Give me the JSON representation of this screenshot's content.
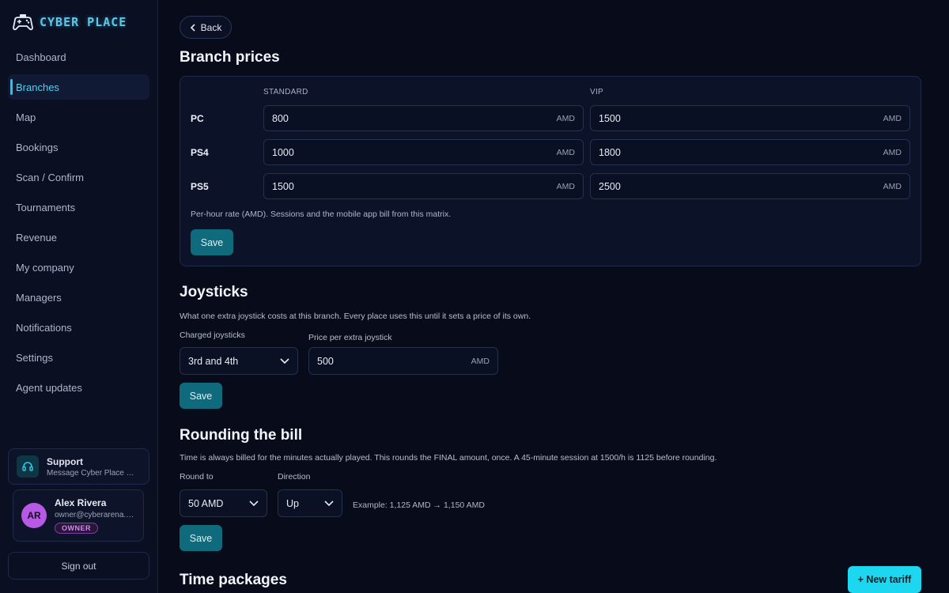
{
  "brand": {
    "name": "CYBER PLACE",
    "icon": "gamepad-icon"
  },
  "sidebar": {
    "items": [
      {
        "label": "Dashboard",
        "active": false
      },
      {
        "label": "Branches",
        "active": true
      },
      {
        "label": "Map",
        "active": false
      },
      {
        "label": "Bookings",
        "active": false
      },
      {
        "label": "Scan / Confirm",
        "active": false
      },
      {
        "label": "Tournaments",
        "active": false
      },
      {
        "label": "Revenue",
        "active": false
      },
      {
        "label": "My company",
        "active": false
      },
      {
        "label": "Managers",
        "active": false
      },
      {
        "label": "Notifications",
        "active": false
      },
      {
        "label": "Settings",
        "active": false
      },
      {
        "label": "Agent updates",
        "active": false
      }
    ],
    "support": {
      "title": "Support",
      "subtitle": "Message Cyber Place su...",
      "icon": "headset-icon"
    },
    "user": {
      "initials": "AR",
      "name": "Alex Rivera",
      "email": "owner@cyberarena.d...",
      "role": "OWNER"
    },
    "sign_out": "Sign out"
  },
  "main": {
    "back_label": "Back",
    "branch_prices": {
      "title": "Branch prices",
      "col_standard": "STANDARD",
      "col_vip": "VIP",
      "unit": "AMD",
      "rows": [
        {
          "label": "PC",
          "standard": "800",
          "vip": "1500"
        },
        {
          "label": "PS4",
          "standard": "1000",
          "vip": "1800"
        },
        {
          "label": "PS5",
          "standard": "1500",
          "vip": "2500"
        }
      ],
      "hint": "Per-hour rate (AMD). Sessions and the mobile app bill from this matrix.",
      "save": "Save"
    },
    "joysticks": {
      "title": "Joysticks",
      "desc": "What one extra joystick costs at this branch. Every place uses this until it sets a price of its own.",
      "charged_label": "Charged joysticks",
      "charged_value": "3rd and 4th",
      "price_label": "Price per extra joystick",
      "price_value": "500",
      "unit": "AMD",
      "save": "Save"
    },
    "rounding": {
      "title": "Rounding the bill",
      "desc": "Time is always billed for the minutes actually played. This rounds the FINAL amount, once. A 45-minute session at 1500/h is 1125 before rounding.",
      "round_to_label": "Round to",
      "round_to_value": "50 AMD",
      "direction_label": "Direction",
      "direction_value": "Up",
      "example": "Example: 1,125 AMD → 1,150 AMD",
      "save": "Save"
    },
    "time_packages": {
      "title": "Time packages",
      "new_tariff": "+ New tariff"
    }
  },
  "colors": {
    "accent": "#1dd6ef",
    "save_bg": "#0f6a7c",
    "background": "#070b1a",
    "avatar": "#b65ae6"
  }
}
